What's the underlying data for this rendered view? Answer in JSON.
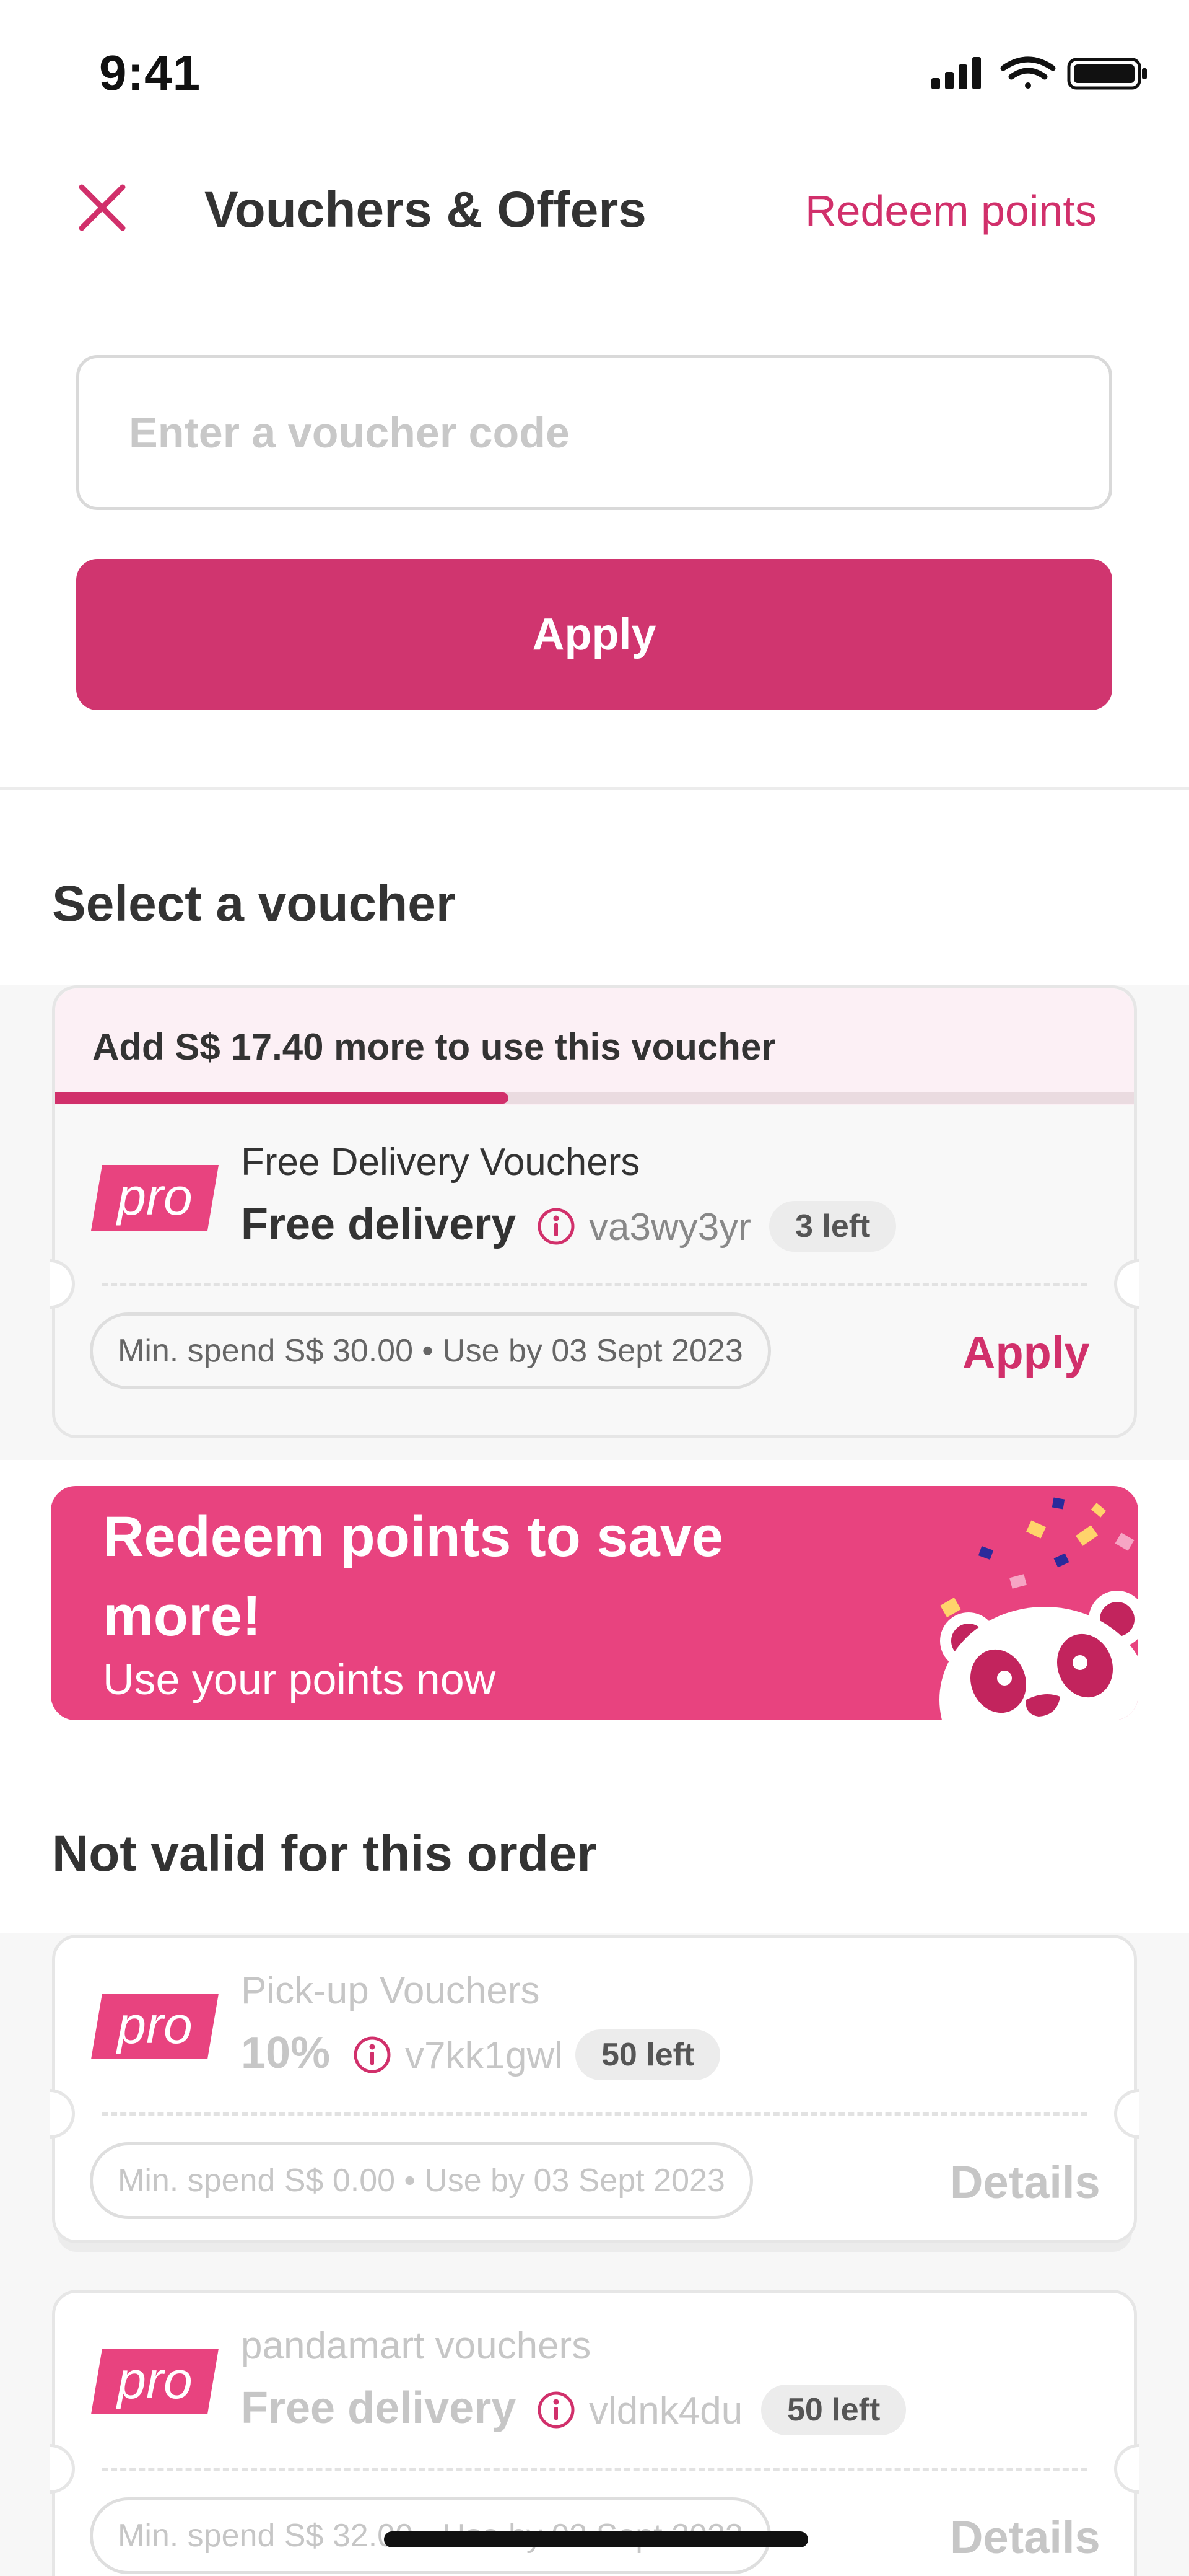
{
  "status_bar": {
    "time": "9:41"
  },
  "header": {
    "title": "Vouchers & Offers",
    "redeem_link": "Redeem points"
  },
  "voucher_entry": {
    "placeholder": "Enter a voucher code",
    "apply_label": "Apply"
  },
  "select_section": {
    "title": "Select a voucher",
    "vouchers": [
      {
        "banner_text": "Add S$ 17.40 more to use this voucher",
        "progress": 0.42,
        "logo_text": "pro",
        "type": "Free Delivery Vouchers",
        "value": "Free delivery",
        "code": "va3wy3yr",
        "left_badge": "3 left",
        "conditions": "Min. spend S$ 30.00 • Use by 03 Sept 2023",
        "action": "Apply"
      }
    ]
  },
  "promo_banner": {
    "title": "Redeem points to save more!",
    "subtitle": "Use your points now"
  },
  "invalid_section": {
    "title": "Not valid for this order",
    "vouchers": [
      {
        "logo_text": "pro",
        "type": "Pick-up Vouchers",
        "value": "10%",
        "code": "v7kk1gwl",
        "left_badge": "50 left",
        "conditions": "Min. spend S$ 0.00 • Use by 03 Sept 2023",
        "action": "Details"
      },
      {
        "logo_text": "pro",
        "type": "pandamart vouchers",
        "value": "Free delivery",
        "code": "vldnk4du",
        "left_badge": "50 left",
        "conditions": "Min. spend S$ 32.00 • Use by 03 Sept 2023",
        "action": "Details"
      }
    ]
  },
  "colors": {
    "brand_pink": "#d1306b",
    "banner_pink": "#e8437f",
    "light_pink": "#fcf0f5"
  }
}
